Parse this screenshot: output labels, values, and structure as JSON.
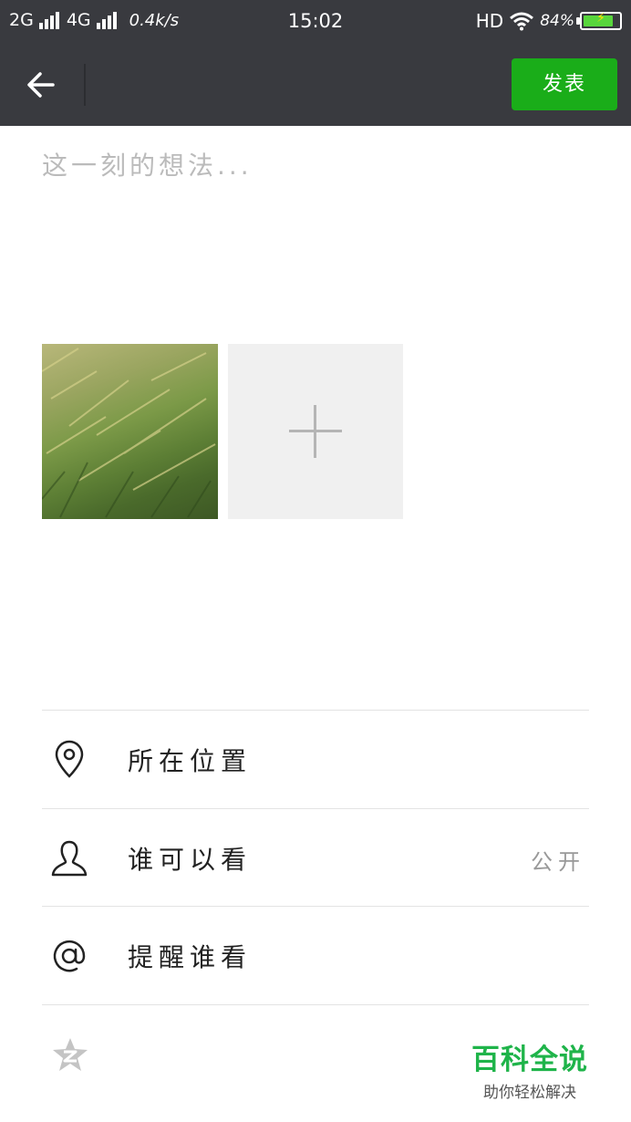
{
  "status_bar": {
    "net1": "2G",
    "net2": "4G",
    "speed": "0.4k/s",
    "time": "15:02",
    "hd": "HD",
    "battery_pct": "84%",
    "battery_level": 0.84
  },
  "header": {
    "publish_label": "发表"
  },
  "composer": {
    "placeholder": "这一刻的想法..."
  },
  "options": [
    {
      "label": "所在位置",
      "value": "",
      "icon": "location-pin-icon"
    },
    {
      "label": "谁可以看",
      "value": "公开",
      "icon": "person-icon"
    },
    {
      "label": "提醒谁看",
      "value": "",
      "icon": "at-sign-icon"
    }
  ],
  "watermark": {
    "title": "百科全说",
    "subtitle": "助你轻松解决"
  },
  "colors": {
    "header_bg": "#393a3f",
    "publish_green": "#1aad19",
    "watermark_green": "#1fb44a"
  }
}
